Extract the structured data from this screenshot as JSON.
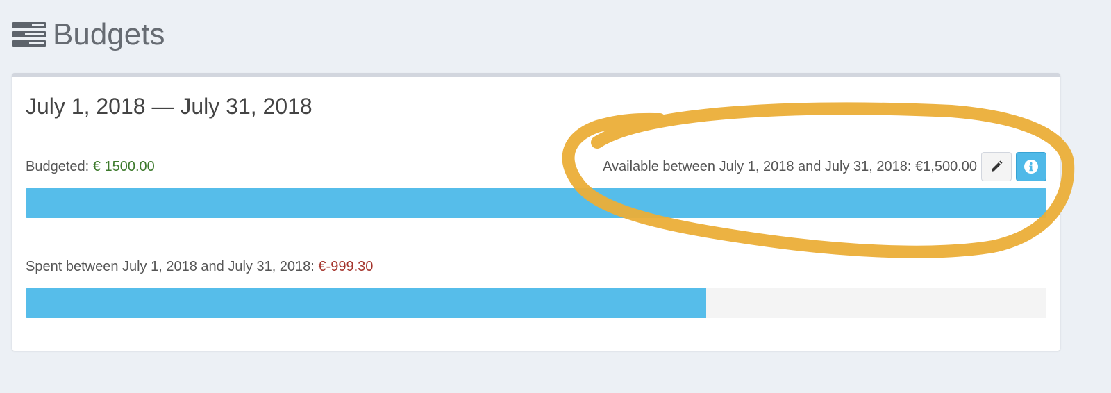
{
  "header": {
    "title": "Budgets",
    "icon": "budgets-stack-icon"
  },
  "budget": {
    "period_title": "July 1, 2018 — July 31, 2018",
    "budgeted_label": "Budgeted:",
    "budgeted_amount": "€ 1500.00",
    "available_text": "Available between July 1, 2018 and July 31, 2018: €1,500.00",
    "budgeted_bar_fraction": 1.0,
    "spent_label": "Spent between July 1, 2018 and July 31, 2018:",
    "spent_amount": "€-999.30",
    "spent_bar_fraction": 0.667,
    "edit_button_icon": "pencil-icon",
    "info_button_icon": "info-icon"
  },
  "colors": {
    "bar": "#56bdea",
    "budgeted_amount": "#3d7a2c",
    "spent_amount": "#a5352d",
    "annotation_ring": "#ebae38"
  }
}
